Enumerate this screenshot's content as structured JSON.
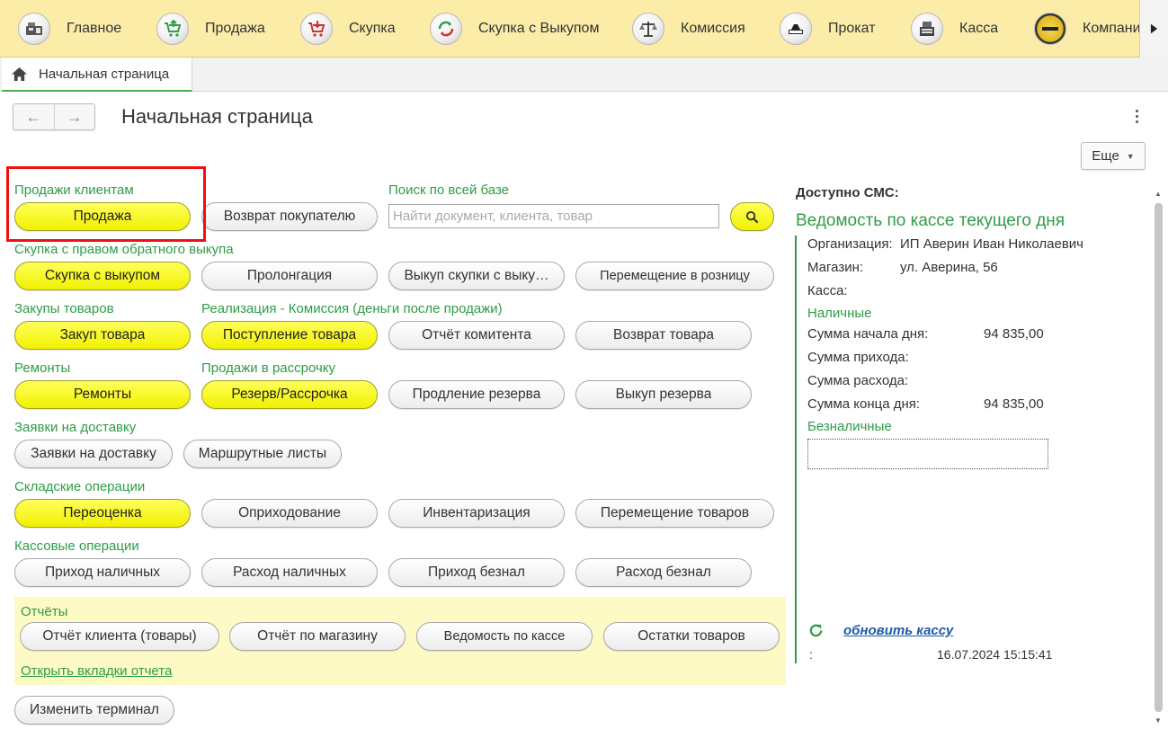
{
  "topbar": {
    "items": [
      {
        "label": "Главное",
        "icon": "cash-register-icon"
      },
      {
        "label": "Продажа",
        "icon": "cart-up-icon"
      },
      {
        "label": "Скупка",
        "icon": "cart-down-icon"
      },
      {
        "label": "Скупка с Выкупом",
        "icon": "cycle-arrows-icon"
      },
      {
        "label": "Комиссия",
        "icon": "scales-icon"
      },
      {
        "label": "Прокат",
        "icon": "rent-icon"
      },
      {
        "label": "Касса",
        "icon": "cash-machine-icon"
      },
      {
        "label": "Компани",
        "icon": "company-logo-icon"
      }
    ]
  },
  "tab": {
    "label": "Начальная страница"
  },
  "page": {
    "title": "Начальная страница",
    "more_label": "Еще"
  },
  "sections": {
    "sales": "Продажи клиентам",
    "search": "Поиск по всей базе",
    "buyback": "Скупка с правом обратного выкупа",
    "purchases": "Закупы товаров",
    "commission": "Реализация - Комиссия (деньги после продажи)",
    "repairs": "Ремонты",
    "installments": "Продажи в рассрочку",
    "delivery": "Заявки на доставку",
    "warehouse": "Складские операции",
    "cash": "Кассовые операции",
    "reports": "Отчёты"
  },
  "buttons": {
    "sale": "Продажа",
    "return_customer": "Возврат покупателю",
    "buyback": "Скупка с выкупом",
    "prolongation": "Пролонгация",
    "buyback_redeem": "Выкуп скупки с выку…",
    "move_retail": "Перемещение в розницу",
    "purchase": "Закуп товара",
    "goods_receipt": "Поступление товара",
    "committent_report": "Отчёт комитента",
    "goods_return": "Возврат товара",
    "repairs": "Ремонты",
    "reserve": "Резерв/Рассрочка",
    "reserve_extend": "Продление резерва",
    "reserve_redeem": "Выкуп резерва",
    "delivery_requests": "Заявки на доставку",
    "route_sheets": "Маршрутные листы",
    "revaluation": "Переоценка",
    "posting": "Оприходование",
    "inventory": "Инвентаризация",
    "goods_move": "Перемещение товаров",
    "cash_in": "Приход наличных",
    "cash_out": "Расход наличных",
    "noncash_in": "Приход безнал",
    "noncash_out": "Расход безнал",
    "report_client": "Отчёт клиента (товары)",
    "report_store": "Отчёт по магазину",
    "report_cash": "Ведомость по кассе",
    "report_stock": "Остатки товаров",
    "change_terminal": "Изменить терминал"
  },
  "search": {
    "placeholder": "Найти документ, клиента, товар",
    "value": ""
  },
  "reports_link": "Открыть вкладки отчета",
  "right": {
    "sms": "Доступно СМС:",
    "heading": "Ведомость по кассе текущего дня",
    "org_label": "Организация:",
    "org_value": "ИП Аверин Иван Николаевич",
    "store_label": "Магазин:",
    "store_value": "ул. Аверина, 56",
    "register_label": "Касса:",
    "cash_title": "Наличные",
    "start_label": "Сумма начала дня:",
    "start_value": "94 835,00",
    "income_label": "Сумма прихода:",
    "expense_label": "Сумма расхода:",
    "end_label": "Сумма конца дня:",
    "end_value": "94 835,00",
    "noncash_title": "Безналичные",
    "refresh_label": "обновить кассу",
    "timestamp_prefix": ":",
    "timestamp": "16.07.2024 15:15:41"
  },
  "colors": {
    "topbar_bg": "#fbeca8",
    "accent_green": "#2e9d46",
    "yellow_button": "#f5f500",
    "highlight_red": "#ee1111",
    "link_blue": "#1e5ba8",
    "reports_bg": "#fdfac6"
  }
}
